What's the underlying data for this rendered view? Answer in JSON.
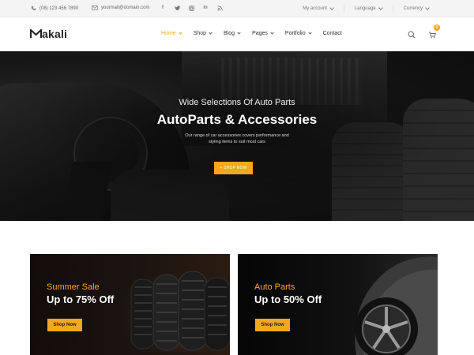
{
  "topbar": {
    "phone": "(08) 123 456 7890",
    "email": "yourmail@domain.com",
    "social_icons": [
      "facebook-icon",
      "twitter-icon",
      "instagram-icon",
      "linkedin-icon",
      "rss-icon"
    ],
    "my_account": "My account",
    "language": "Language",
    "currency": "Currency"
  },
  "header": {
    "logo": "akali",
    "logo_mark": "M",
    "nav": [
      {
        "label": "Home",
        "dropdown": true,
        "active": true
      },
      {
        "label": "Shop",
        "dropdown": true
      },
      {
        "label": "Blog",
        "dropdown": true
      },
      {
        "label": "Pages",
        "dropdown": true
      },
      {
        "label": "Portfolio",
        "dropdown": true
      },
      {
        "label": "Contact",
        "dropdown": false
      }
    ],
    "cart_count": "0"
  },
  "hero": {
    "subtitle": "Wide Selections Of Auto Parts",
    "title": "AutoParts & Accessories",
    "description": "Our range of car accessories covers performance and styling items to suit most cars",
    "button": "+ SHOP NOW"
  },
  "banners": [
    {
      "label": "Summer Sale",
      "headline": "Up to 75% Off",
      "button": "Shop Now"
    },
    {
      "label": "Auto Parts",
      "headline": "Up to 50% Off",
      "button": "Shop Now"
    }
  ],
  "colors": {
    "accent": "#f4a81e",
    "dark": "#111111"
  }
}
